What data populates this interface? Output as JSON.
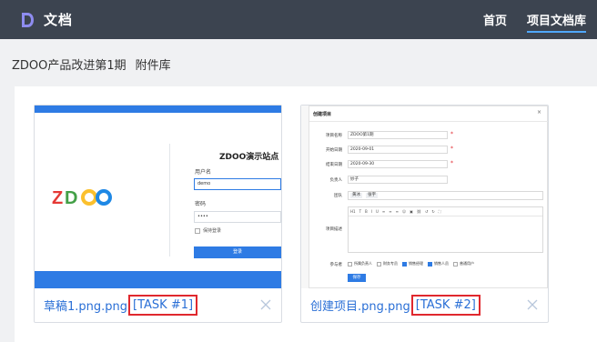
{
  "header": {
    "app_title": "文档",
    "logo_icon": "doc-logo-icon",
    "nav": [
      {
        "label": "首页",
        "active": false
      },
      {
        "label": "项目文档库",
        "active": true
      }
    ],
    "background": "#3c4450",
    "active_underline": "#4fa8ff"
  },
  "breadcrumb": {
    "project": "ZDOO产品改进第1期",
    "section": "附件库"
  },
  "attachments": [
    {
      "file_name": "草稿1.png.png",
      "tag": "[TASK #1]",
      "close_icon": "close-icon",
      "preview": {
        "site_title": "ZDOO演示站点",
        "username_label": "用户名",
        "username_value": "demo",
        "password_label": "密码",
        "password_value": "••••",
        "remember_label": "保持登录",
        "login_button": "登录",
        "brand_logo": "ZDOO"
      }
    },
    {
      "file_name": "创建项目.png.png",
      "tag": "[TASK #2]",
      "close_icon": "close-icon",
      "preview": {
        "dialog_title": "创建项目",
        "fields": [
          {
            "label": "项目名称",
            "value": "ZDOO第1期"
          },
          {
            "label": "开始日期",
            "value": "2020-09-01"
          },
          {
            "label": "结束日期",
            "value": "2020-09-30"
          },
          {
            "label": "负责人",
            "value": "妙子"
          }
        ],
        "team_label": "团队",
        "team_members": [
          "黄冰",
          "张宇"
        ],
        "desc_label": "项目描述",
        "toolbar": [
          "H1",
          "T",
          "B",
          "I",
          "U",
          "≡",
          "≡",
          "≡",
          "☺",
          "▣",
          "⛓",
          "↺",
          "↻",
          "⛶"
        ],
        "participants_label": "参与者",
        "participants": [
          {
            "label": "所属负责人",
            "checked": false
          },
          {
            "label": "财务专员",
            "checked": false
          },
          {
            "label": "销售经理",
            "checked": true
          },
          {
            "label": "销售人员",
            "checked": true
          },
          {
            "label": "普通用户",
            "checked": false
          }
        ],
        "save_button": "保存"
      }
    }
  ],
  "colors": {
    "link": "#2a6fd6",
    "highlight_border": "#e0282e",
    "brand_blue": "#2e7be4"
  }
}
